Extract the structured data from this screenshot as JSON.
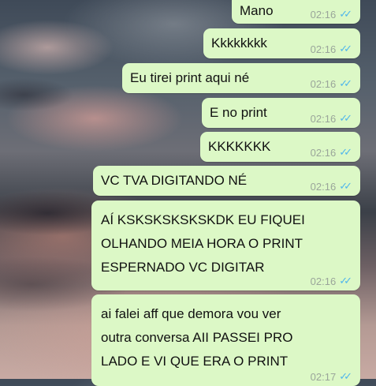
{
  "chat": {
    "messages": [
      {
        "text": "Mano",
        "time": "02:16",
        "status": "read"
      },
      {
        "text": "Kkkkkkkk",
        "time": "02:16",
        "status": "read"
      },
      {
        "text": "Eu tirei print aqui né",
        "time": "02:16",
        "status": "read"
      },
      {
        "text": "E no print",
        "time": "02:16",
        "status": "read"
      },
      {
        "text": "KKKKKKK",
        "time": "02:16",
        "status": "read"
      },
      {
        "text": "VC TVA DIGITANDO NÉ",
        "time": "02:16",
        "status": "read"
      },
      {
        "lines": [
          "AÍ KSKSKSKSKSKDK EU FIQUEI",
          "OLHANDO MEIA HORA O PRINT",
          "ESPERNADO VC DIGITAR"
        ],
        "time": "02:16",
        "status": "read"
      },
      {
        "lines": [
          "ai falei aff que demora vou ver",
          "outra conversa AII PASSEI PRO",
          "LADO E VI QUE ERA O PRINT"
        ],
        "time": "02:17",
        "status": "read"
      }
    ]
  },
  "colors": {
    "bubble_outgoing": "#dcf8c6",
    "read_ticks": "#4fb6ec",
    "timestamp": "#9aa59a"
  },
  "icons": {
    "read_receipt": "double-check-icon"
  }
}
